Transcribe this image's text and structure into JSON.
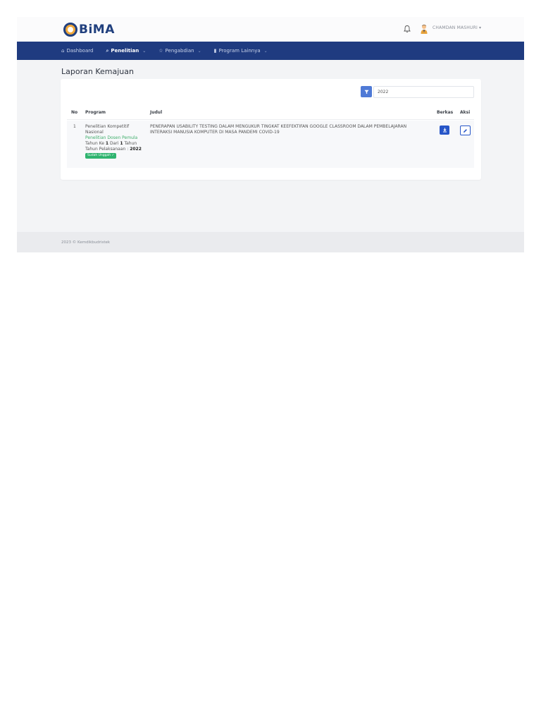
{
  "header": {
    "logo_text": "BiMA",
    "user_name": "CHAMDAN MASHURI",
    "user_caret": "▾"
  },
  "nav": {
    "items": [
      {
        "label": "Dashboard",
        "icon": "home-icon",
        "active": false,
        "dropdown": false
      },
      {
        "label": "Penelitian",
        "icon": "search-icon",
        "active": true,
        "dropdown": true
      },
      {
        "label": "Pengabdian",
        "icon": "star-icon",
        "active": false,
        "dropdown": true
      },
      {
        "label": "Program Lainnya",
        "icon": "document-icon",
        "active": false,
        "dropdown": true
      }
    ],
    "chevron": "⌄"
  },
  "page": {
    "title": "Laporan Kemajuan"
  },
  "filter": {
    "year_value": "2022"
  },
  "table": {
    "headers": {
      "no": "No",
      "program": "Program",
      "judul": "Judul",
      "berkas": "Berkas",
      "aksi": "Aksi"
    },
    "rows": [
      {
        "no": "1",
        "program_line1": "Penelitian Kompetitif",
        "program_line2": "Nasional",
        "sub_program": "Penelitian Dosen Pemula",
        "tahun_ke_prefix": "Tahun Ke ",
        "tahun_ke": "1",
        "tahun_dari": " Dari ",
        "tahun_total": "1",
        "tahun_suffix": " Tahun",
        "pelaksanaan_label": "Tahun Pelaksanaan : ",
        "pelaksanaan_value": "2022",
        "status_badge": "Sudah Unggah ✓",
        "judul": "PENERAPAN USABILITY TESTING DALAM MENGUKUR TINGKAT KEEFEKTIFAN GOOGLE CLASSROOM DALAM PEMBELAJARAN INTERAKSI MANUSIA KOMPUTER DI MASA PANDEMI COVID-19"
      }
    ]
  },
  "footer": {
    "text": "2023 © Kemdikbudristek"
  },
  "colors": {
    "navbar": "#1f3b80",
    "accent": "#2756c8",
    "success": "#2fb46f"
  }
}
